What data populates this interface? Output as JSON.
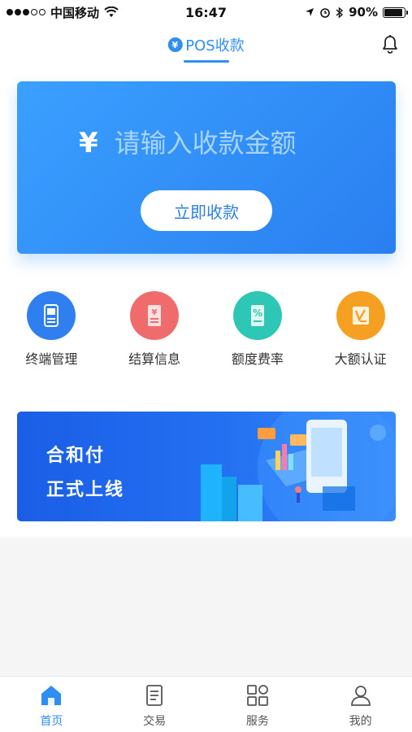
{
  "status_bar": {
    "carrier": "中国移动",
    "time": "16:47",
    "battery": "90%"
  },
  "header": {
    "title": "POS收款",
    "yen_badge": "¥"
  },
  "amount_card": {
    "currency_symbol": "¥",
    "placeholder": "请输入收款金额",
    "button_label": "立即收款"
  },
  "actions": [
    {
      "label": "终端管理",
      "icon": "pos-terminal-icon",
      "color": "#2f7ff0"
    },
    {
      "label": "结算信息",
      "icon": "settlement-receipt-icon",
      "color": "#f06c6c"
    },
    {
      "label": "额度费率",
      "icon": "percent-document-icon",
      "color": "#2ec7b5"
    },
    {
      "label": "大额认证",
      "icon": "certification-icon",
      "color": "#f5a020"
    }
  ],
  "banner": {
    "line1": "合和付",
    "line2": "正式上线"
  },
  "tabs": [
    {
      "label": "首页",
      "icon": "home-icon",
      "active": true
    },
    {
      "label": "交易",
      "icon": "document-icon",
      "active": false
    },
    {
      "label": "服务",
      "icon": "grid-icon",
      "active": false
    },
    {
      "label": "我的",
      "icon": "user-icon",
      "active": false
    }
  ],
  "colors": {
    "accent": "#2f8ef0",
    "card_gradient_start": "#3aa0ff",
    "card_gradient_end": "#2a7ff0"
  }
}
